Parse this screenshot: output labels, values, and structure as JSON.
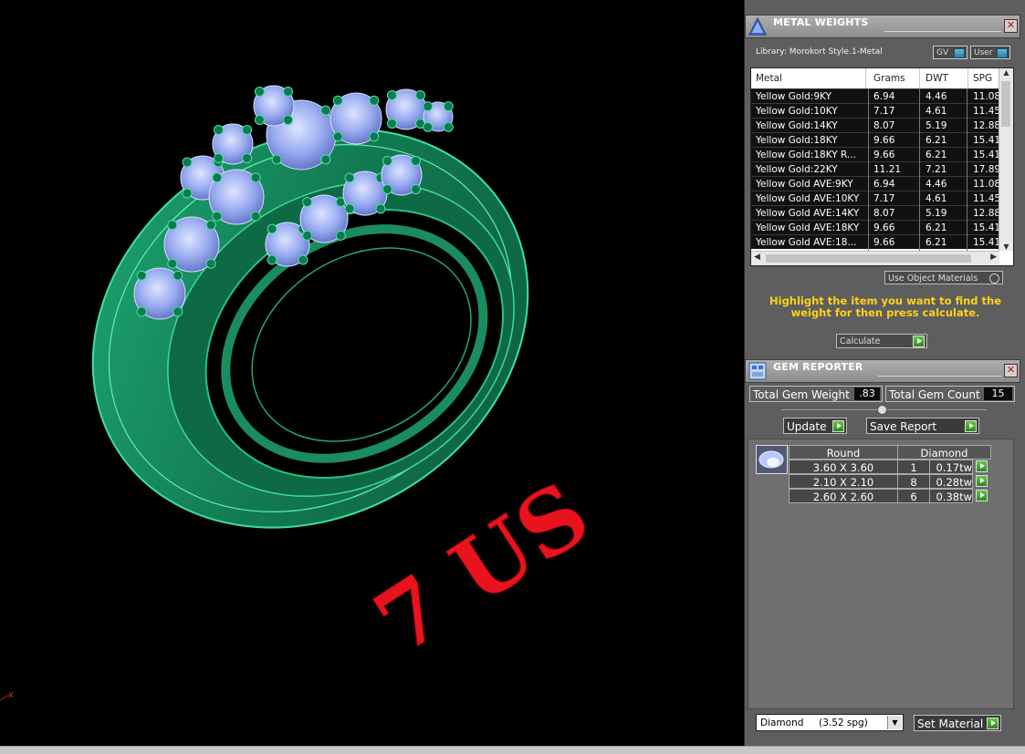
{
  "viewport": {
    "ring_label": "7 US",
    "axis_label": "x",
    "colors": {
      "ring": "#158a5c",
      "gem": "#9fb2ee",
      "label": "#e8131c"
    }
  },
  "metal_weights": {
    "title": "METAL WEIGHTS",
    "library": "Library: Morokort Style.1-Metal",
    "gv_button": "GV",
    "user_button": "User",
    "columns": [
      "Metal",
      "Grams",
      "DWT",
      "SPG"
    ],
    "rows": [
      {
        "metal": "Yellow Gold:9KY",
        "grams": "6.94",
        "dwt": "4.46",
        "spg": "11.08"
      },
      {
        "metal": "Yellow Gold:10KY",
        "grams": "7.17",
        "dwt": "4.61",
        "spg": "11.45"
      },
      {
        "metal": "Yellow Gold:14KY",
        "grams": "8.07",
        "dwt": "5.19",
        "spg": "12.88"
      },
      {
        "metal": "Yellow Gold:18KY",
        "grams": "9.66",
        "dwt": "6.21",
        "spg": "15.41"
      },
      {
        "metal": "Yellow Gold:18KY R...",
        "grams": "9.66",
        "dwt": "6.21",
        "spg": "15.41"
      },
      {
        "metal": "Yellow Gold:22KY",
        "grams": "11.21",
        "dwt": "7.21",
        "spg": "17.89"
      },
      {
        "metal": "Yellow Gold AVE:9KY",
        "grams": "6.94",
        "dwt": "4.46",
        "spg": "11.08"
      },
      {
        "metal": "Yellow Gold AVE:10KY",
        "grams": "7.17",
        "dwt": "4.61",
        "spg": "11.45"
      },
      {
        "metal": "Yellow Gold AVE:14KY",
        "grams": "8.07",
        "dwt": "5.19",
        "spg": "12.88"
      },
      {
        "metal": "Yellow Gold AVE:18KY",
        "grams": "9.66",
        "dwt": "6.21",
        "spg": "15.41"
      },
      {
        "metal": "Yellow Gold AVE:18...",
        "grams": "9.66",
        "dwt": "6.21",
        "spg": "15.41"
      }
    ],
    "use_object_materials": "Use Object Materials",
    "hint": "Highlight the item you want to find the weight for then press calculate.",
    "calculate": "Calculate"
  },
  "gem_reporter": {
    "title": "GEM REPORTER",
    "total_gem_weight_label": "Total Gem Weight",
    "total_gem_weight": ".83",
    "total_gem_count_label": "Total Gem Count",
    "total_gem_count": "15",
    "update": "Update",
    "save_report": "Save Report",
    "shape": "Round",
    "stone": "Diamond",
    "gems": [
      {
        "size": "3.60 X 3.60",
        "count": "1",
        "weight": "0.17tw"
      },
      {
        "size": "2.10 X 2.10",
        "count": "8",
        "weight": "0.28tw"
      },
      {
        "size": "2.60 X 2.60",
        "count": "6",
        "weight": "0.38tw"
      }
    ],
    "material_select": "Diamond     (3.52 spg)",
    "set_material": "Set Material"
  }
}
